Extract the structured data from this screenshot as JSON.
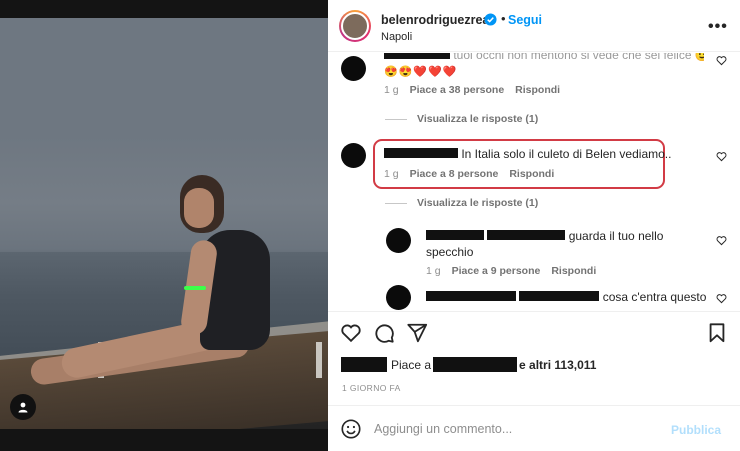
{
  "header": {
    "username": "belenrodriguezreal",
    "dot": "•",
    "follow_label": "Segui",
    "location": "Napoli",
    "more_label": "•••"
  },
  "comments": [
    {
      "partial_text": "tuoi occhi non mentono si vede che sei felice 😉",
      "emojis": "😍😍❤️❤️❤️",
      "time": "1 g",
      "likes": "Piace a 38 persone",
      "reply_label": "Rispondi",
      "view_replies": "Visualizza le risposte (1)"
    },
    {
      "text": "In Italia solo il culeto di Belen vediamo..",
      "time": "1 g",
      "likes": "Piace a 8 persone",
      "reply_label": "Rispondi",
      "view_replies": "Visualizza le risposte (1)"
    }
  ],
  "replies": [
    {
      "text_line1": "guarda il tuo nello",
      "text_line2": "specchio",
      "time": "1 g",
      "likes": "Piace a 9 persone",
      "reply_label": "Rispondi"
    },
    {
      "text_line1": "cosa c'entra questo"
    }
  ],
  "post": {
    "likes_prefix": "Piace a",
    "likes_suffix": "e altri 113,011",
    "date": "1 GIORNO FA"
  },
  "composer": {
    "placeholder": "Aggiungi un commento...",
    "publish_label": "Pubblica"
  },
  "colors": {
    "accent": "#0095f6",
    "highlight": "#d23b45",
    "publish_disabled": "#b2dffc"
  }
}
